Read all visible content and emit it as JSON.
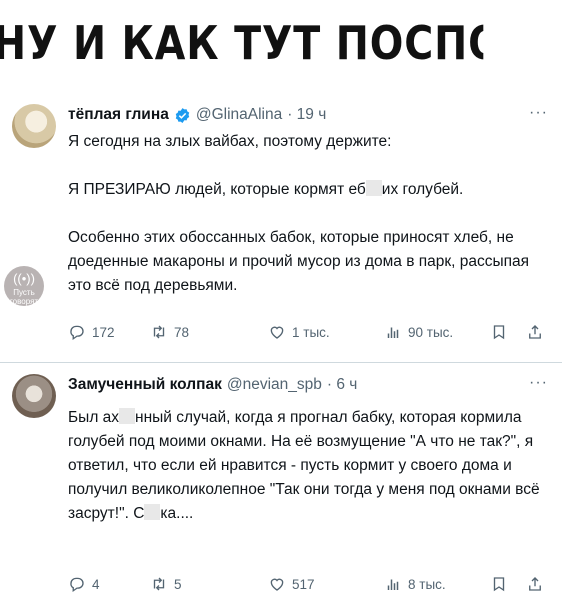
{
  "headline": "НУ И КАК ТУТ ПОСПОРИШЬ",
  "watermark": {
    "text": "Пусть говорят"
  },
  "tweets": [
    {
      "author_name": "тёплая глина",
      "verified": true,
      "handle": "@GlinaAlina",
      "time": "· 19 ч",
      "more": "···",
      "paragraphs": [
        "Я сегодня на злых вайбах, поэтому держите:",
        "Я ПРЕЗИРАЮ людей, которые кормят еб",
        "Особенно этих обоссанных бабок, которые приносят хлеб, не доеденные макароны и прочий мусор из дома в парк, рассыпая это всё под деревьями."
      ],
      "p2_tail": "их голубей.",
      "stats": {
        "replies": "172",
        "retweets": "78",
        "likes": "1 тыс.",
        "views": "90 тыс."
      }
    },
    {
      "author_name": "Замученный колпак",
      "verified": false,
      "handle": "@nevian_spb",
      "time": "· 6 ч",
      "more": "···",
      "text_a": "Был ах",
      "text_b": "нный случай, когда я прогнал бабку, которая кормила голубей под моими окнами. На её возмущение \"А что не так?\", я ответил, что если ей нравится - пусть кормит у своего дома и получил великоликолепное \"Так они тогда у меня под окнами всё засрут!\". С",
      "text_c": "ка....",
      "stats": {
        "replies": "4",
        "retweets": "5",
        "likes": "517",
        "views": "8 тыс."
      }
    }
  ],
  "icons": {
    "reply": "reply-icon",
    "retweet": "retweet-icon",
    "like": "heart-icon",
    "views": "views-icon",
    "bookmark": "bookmark-icon",
    "share": "share-icon",
    "verified": "verified-badge-icon"
  },
  "colors": {
    "text": "#0f1419",
    "muted": "#536471",
    "verified": "#1d9bf0",
    "divider": "#cfd9de"
  }
}
